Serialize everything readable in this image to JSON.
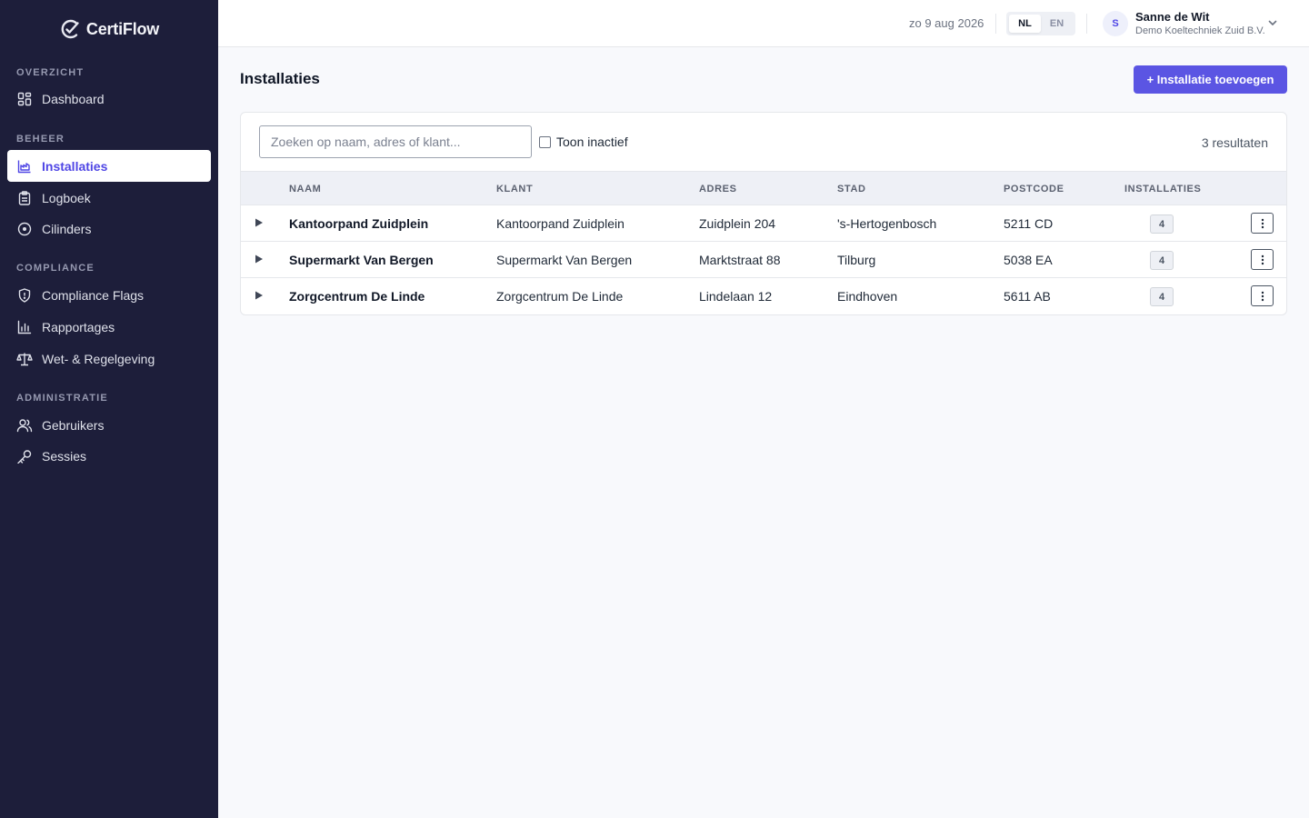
{
  "app": {
    "name": "CertiFlow"
  },
  "sidebar": {
    "sections": [
      {
        "label": "OVERZICHT"
      },
      {
        "label": "BEHEER"
      },
      {
        "label": "COMPLIANCE"
      },
      {
        "label": "ADMINISTRATIE"
      }
    ],
    "items": [
      {
        "label": "Dashboard",
        "icon": "dashboard-icon"
      },
      {
        "label": "Installaties",
        "icon": "installations-icon",
        "active": true
      },
      {
        "label": "Logboek",
        "icon": "clipboard-icon"
      },
      {
        "label": "Cilinders",
        "icon": "cylinder-icon"
      },
      {
        "label": "Compliance Flags",
        "icon": "shield-icon"
      },
      {
        "label": "Rapportages",
        "icon": "bar-chart-icon"
      },
      {
        "label": "Wet- & Regelgeving",
        "icon": "scale-icon"
      },
      {
        "label": "Gebruikers",
        "icon": "users-icon"
      },
      {
        "label": "Sessies",
        "icon": "key-icon"
      }
    ]
  },
  "header": {
    "date": "zo 9 aug 2026",
    "languages": [
      {
        "code": "NL",
        "active": true
      },
      {
        "code": "EN",
        "active": false
      }
    ],
    "user": {
      "initial": "S",
      "name": "Sanne de Wit",
      "organization": "Demo Koeltechniek Zuid B.V."
    }
  },
  "main": {
    "title": "Installaties",
    "add_button": "+ Installatie toevoegen",
    "search": {
      "placeholder": "Zoeken op naam, adres of klant...",
      "value": ""
    },
    "show_inactive": {
      "label": "Toon inactief",
      "checked": false
    },
    "results": "3 resultaten",
    "table": {
      "columns": [
        "NAAM",
        "KLANT",
        "ADRES",
        "STAD",
        "POSTCODE",
        "INSTALLATIES"
      ],
      "rows": [
        {
          "naam": "Kantoorpand Zuidplein",
          "klant": "Kantoorpand Zuidplein",
          "adres": "Zuidplein 204",
          "stad": "'s-Hertogenbosch",
          "postcode": "5211 CD",
          "installaties": "4"
        },
        {
          "naam": "Supermarkt Van Bergen",
          "klant": "Supermarkt Van Bergen",
          "adres": "Marktstraat 88",
          "stad": "Tilburg",
          "postcode": "5038 EA",
          "installaties": "4"
        },
        {
          "naam": "Zorgcentrum De Linde",
          "klant": "Zorgcentrum De Linde",
          "adres": "Lindelaan 12",
          "stad": "Eindhoven",
          "postcode": "5611 AB",
          "installaties": "4"
        }
      ]
    }
  },
  "colors": {
    "sidebar_bg": "#1d1e3a",
    "accent": "#5b55e3",
    "active_text": "#4f46e5"
  }
}
